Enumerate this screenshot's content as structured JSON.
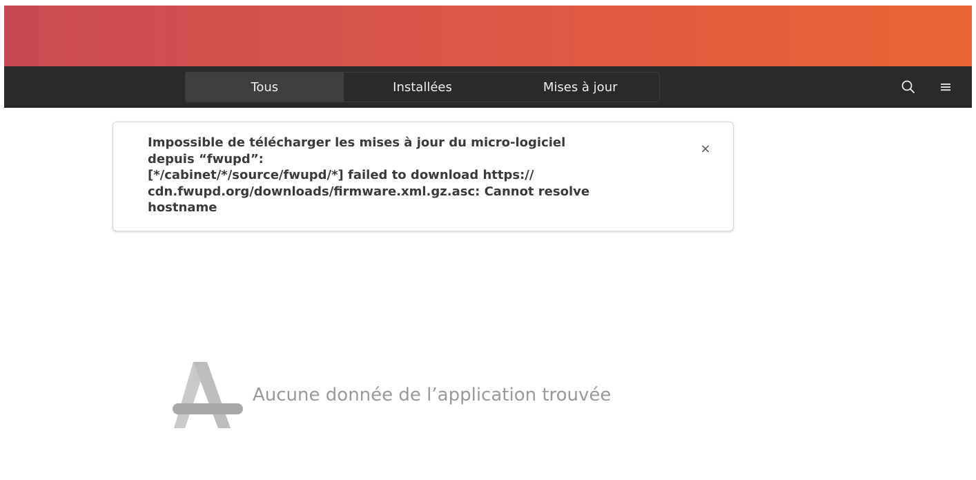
{
  "header": {
    "tabs": [
      {
        "label": "Tous",
        "active": true
      },
      {
        "label": "Installées",
        "active": false
      },
      {
        "label": "Mises à jour",
        "active": false
      }
    ],
    "search_icon": "search-icon",
    "menu_icon": "hamburger-menu-icon"
  },
  "notification": {
    "message": "Impossible de télécharger les mises à jour du micro-logiciel\ndepuis “fwupd”:\n[*/cabinet/*/source/fwupd/*] failed to download https://\ncdn.fwupd.org/downloads/firmware.xml.gz.asc: Cannot resolve\nhostname",
    "close_label": "×"
  },
  "empty_state": {
    "icon": "app-store-icon",
    "text": "Aucune donnée de l’application trouvée"
  },
  "colors": {
    "wallpaper_start": "#c74a54",
    "wallpaper_end": "#ec6434",
    "headerbar": "#2b2a29",
    "active_tab": "#3f3e3c",
    "empty_text": "#9a9a9a"
  }
}
